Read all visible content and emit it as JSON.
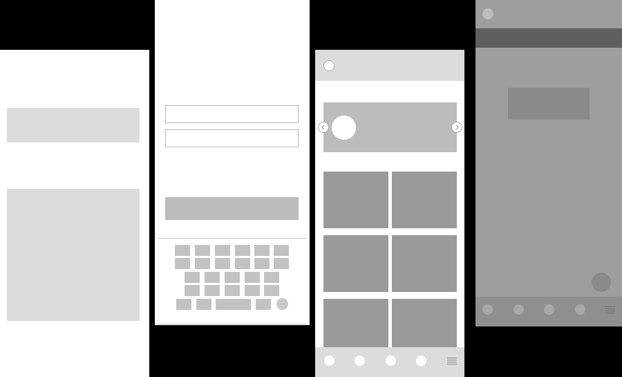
{
  "colors": {
    "background": "#000000",
    "screen_white": "#ffffff",
    "placeholder_light": "#dcdcdc",
    "placeholder_mid": "#bcbcbc",
    "tile": "#9a9a9a",
    "overlay": "#9e9e9e",
    "app_bar_dark": "#5f5f5f",
    "fab": "#8a8a8a"
  },
  "screens": [
    {
      "name": "content-screen",
      "icons": []
    },
    {
      "name": "login-screen",
      "icons": [
        "keyboard-icon",
        "mic-icon"
      ]
    },
    {
      "name": "gallery-screen",
      "icons": [
        "avatar-icon",
        "chevron-left-icon",
        "chevron-right-icon",
        "menu-icon"
      ]
    },
    {
      "name": "dialog-overlay-screen",
      "icons": [
        "avatar-icon",
        "fab-icon",
        "menu-icon"
      ]
    }
  ]
}
